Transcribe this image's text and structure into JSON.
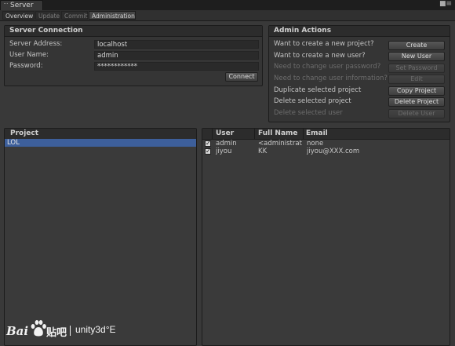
{
  "window": {
    "title": "Server"
  },
  "tabs": [
    {
      "label": "Overview"
    },
    {
      "label": "Update"
    },
    {
      "label": "Commit"
    },
    {
      "label": "Administration"
    }
  ],
  "connection": {
    "title": "Server Connection",
    "server_address_label": "Server Address:",
    "server_address_value": "localhost",
    "user_name_label": "User Name:",
    "user_name_value": "admin",
    "password_label": "Password:",
    "password_value": "************",
    "connect_label": "Connect"
  },
  "admin": {
    "title": "Admin Actions",
    "rows": [
      {
        "text": "Want to create a new project?",
        "button": "Create",
        "enabled": true
      },
      {
        "text": "Want to create a new user?",
        "button": "New User",
        "enabled": true
      },
      {
        "text": "Need to change user password?",
        "button": "Set Password",
        "enabled": false
      },
      {
        "text": "Need to change user information?",
        "button": "Edit",
        "enabled": false
      },
      {
        "text": "Duplicate selected project",
        "button": "Copy Project",
        "enabled": true
      },
      {
        "text": "Delete selected project",
        "button": "Delete Project",
        "enabled": true
      },
      {
        "text": "Delete selected user",
        "button": "Delete User",
        "enabled": false
      }
    ]
  },
  "projects": {
    "header": "Project",
    "items": [
      {
        "name": "LOL",
        "selected": true
      }
    ]
  },
  "users": {
    "headers": {
      "user": "User",
      "full_name": "Full Name",
      "email": "Email"
    },
    "rows": [
      {
        "checked": true,
        "user": "admin",
        "full_name": "<administrator>",
        "email": "none"
      },
      {
        "checked": true,
        "user": "jiyou",
        "full_name": "KK",
        "email": "jiyou@XXX.com"
      }
    ]
  },
  "watermark": {
    "bai": "Bai",
    "du": "贴吧",
    "site": "unity3d°E"
  },
  "colors": {
    "selection": "#3d5f9b",
    "background": "#393939"
  }
}
